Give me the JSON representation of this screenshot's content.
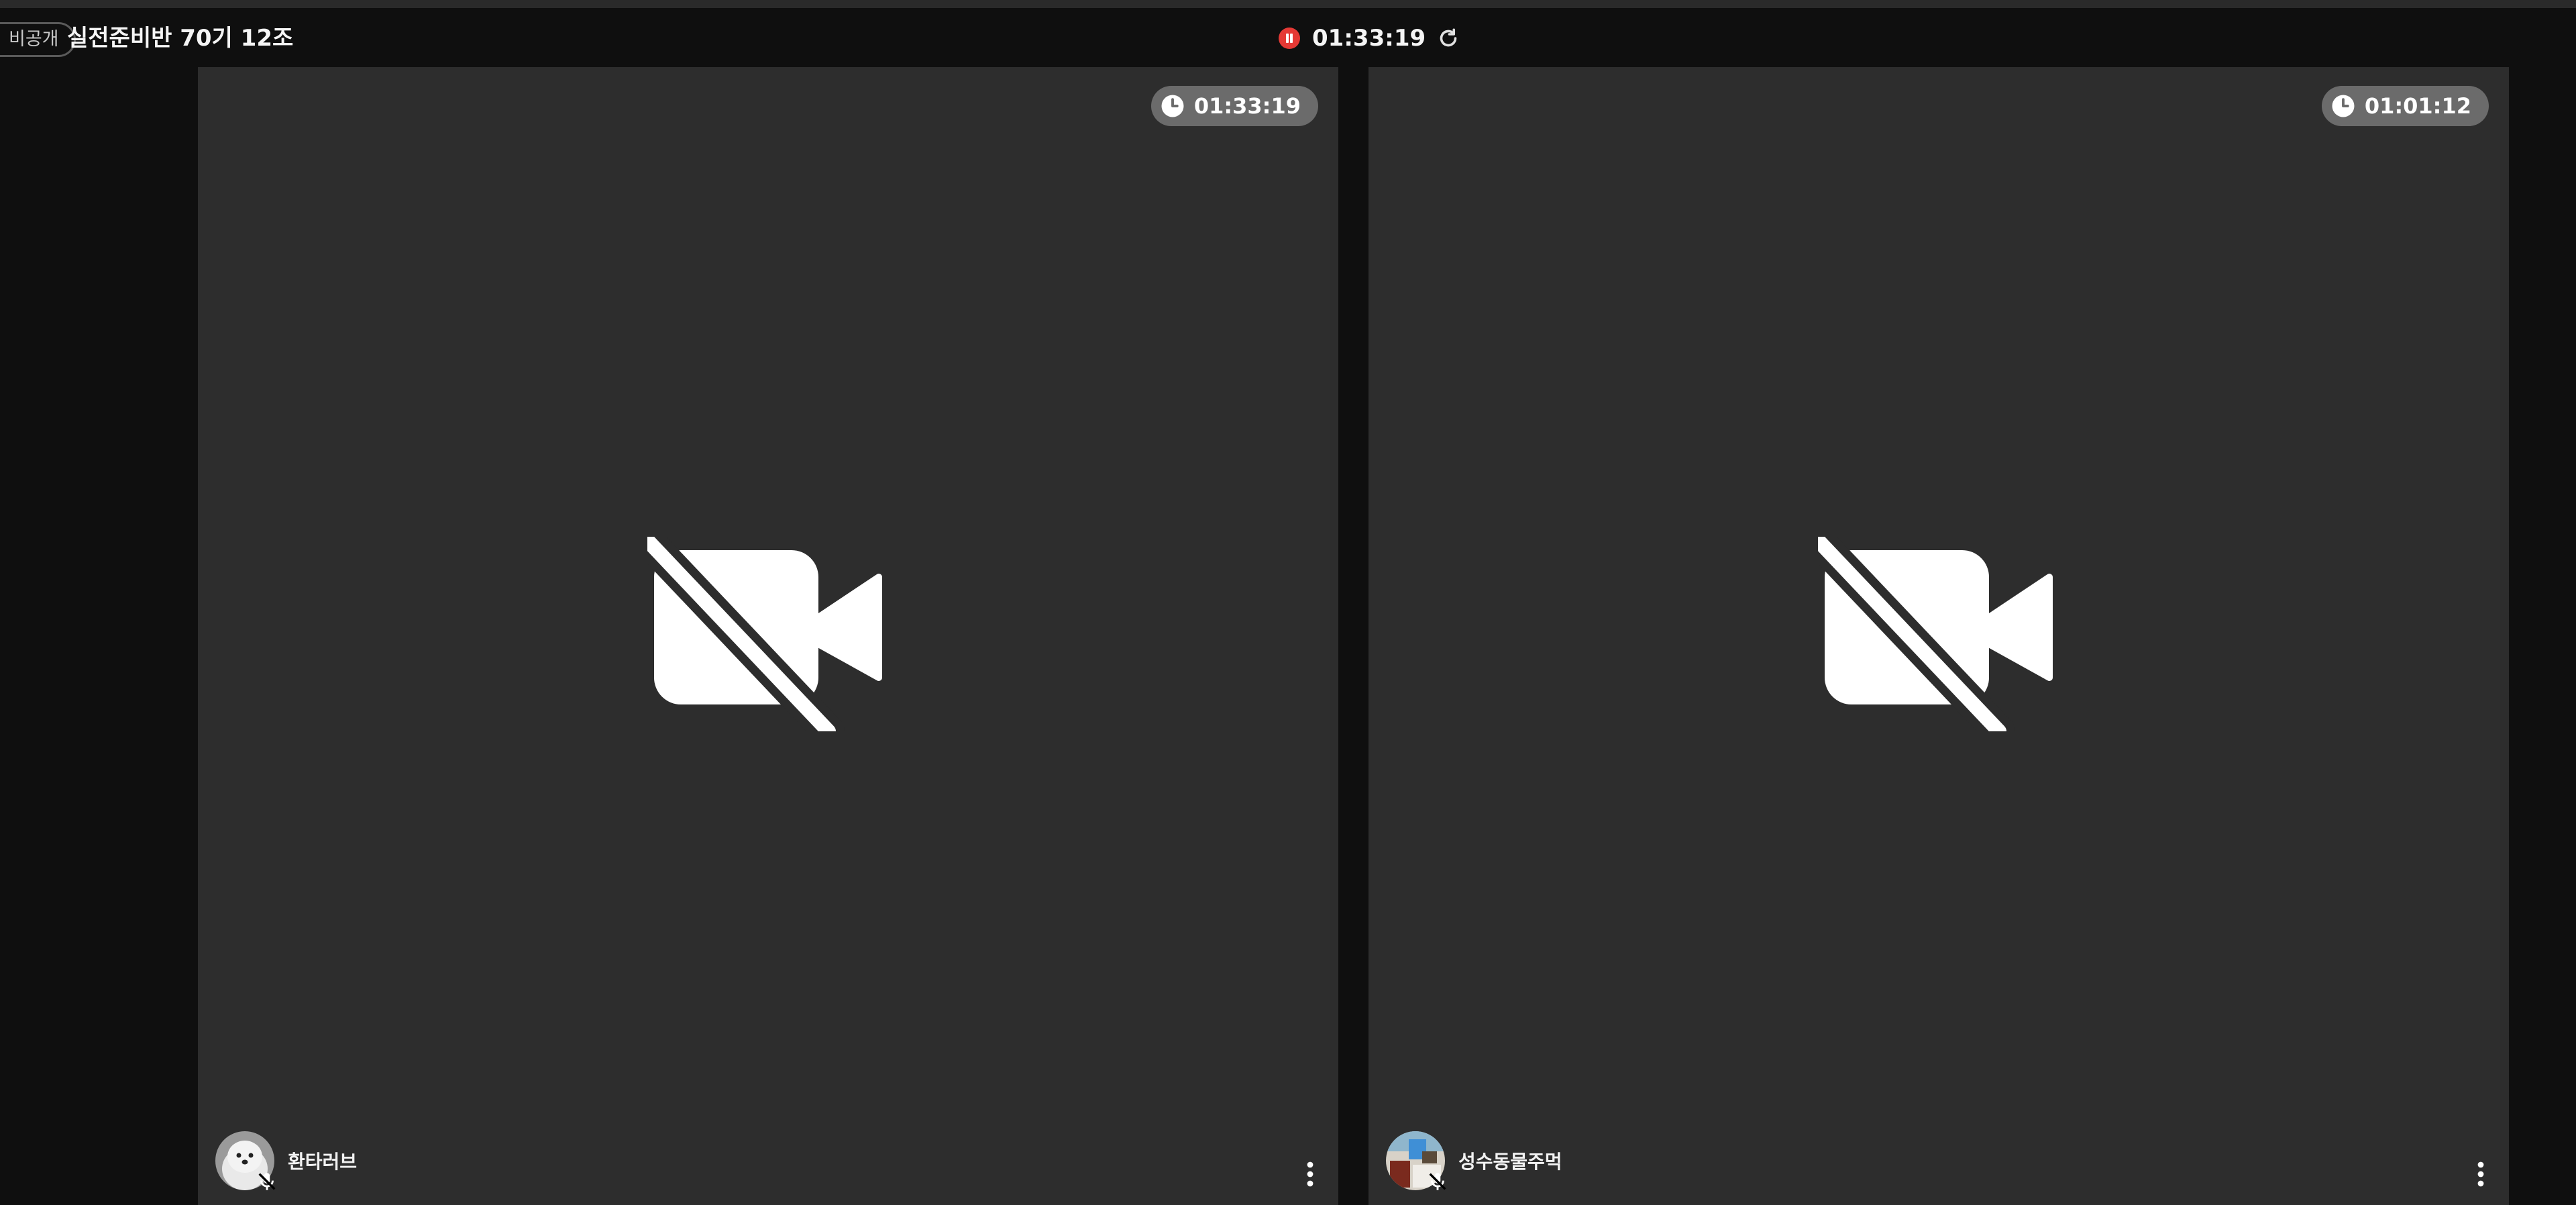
{
  "header": {
    "privacy_badge": "비공개",
    "room_title": "실전준비반 70기 12조",
    "recording_time": "01:33:19"
  },
  "tiles": [
    {
      "timer": "01:33:19",
      "participant_name": "환타러브",
      "avatar": "dog-avatar"
    },
    {
      "timer": "01:01:12",
      "participant_name": "성수동물주먹",
      "avatar": "room-photo-avatar"
    }
  ],
  "colors": {
    "recording": "#e53935",
    "tile_background": "#2d2d2d",
    "page_background": "#0f0f0f",
    "timer_pill": "#6b6b6b"
  },
  "icons": [
    "pause-icon",
    "refresh-icon",
    "clock-icon",
    "camera-off-icon",
    "mic-off-icon",
    "more-vertical-icon"
  ]
}
